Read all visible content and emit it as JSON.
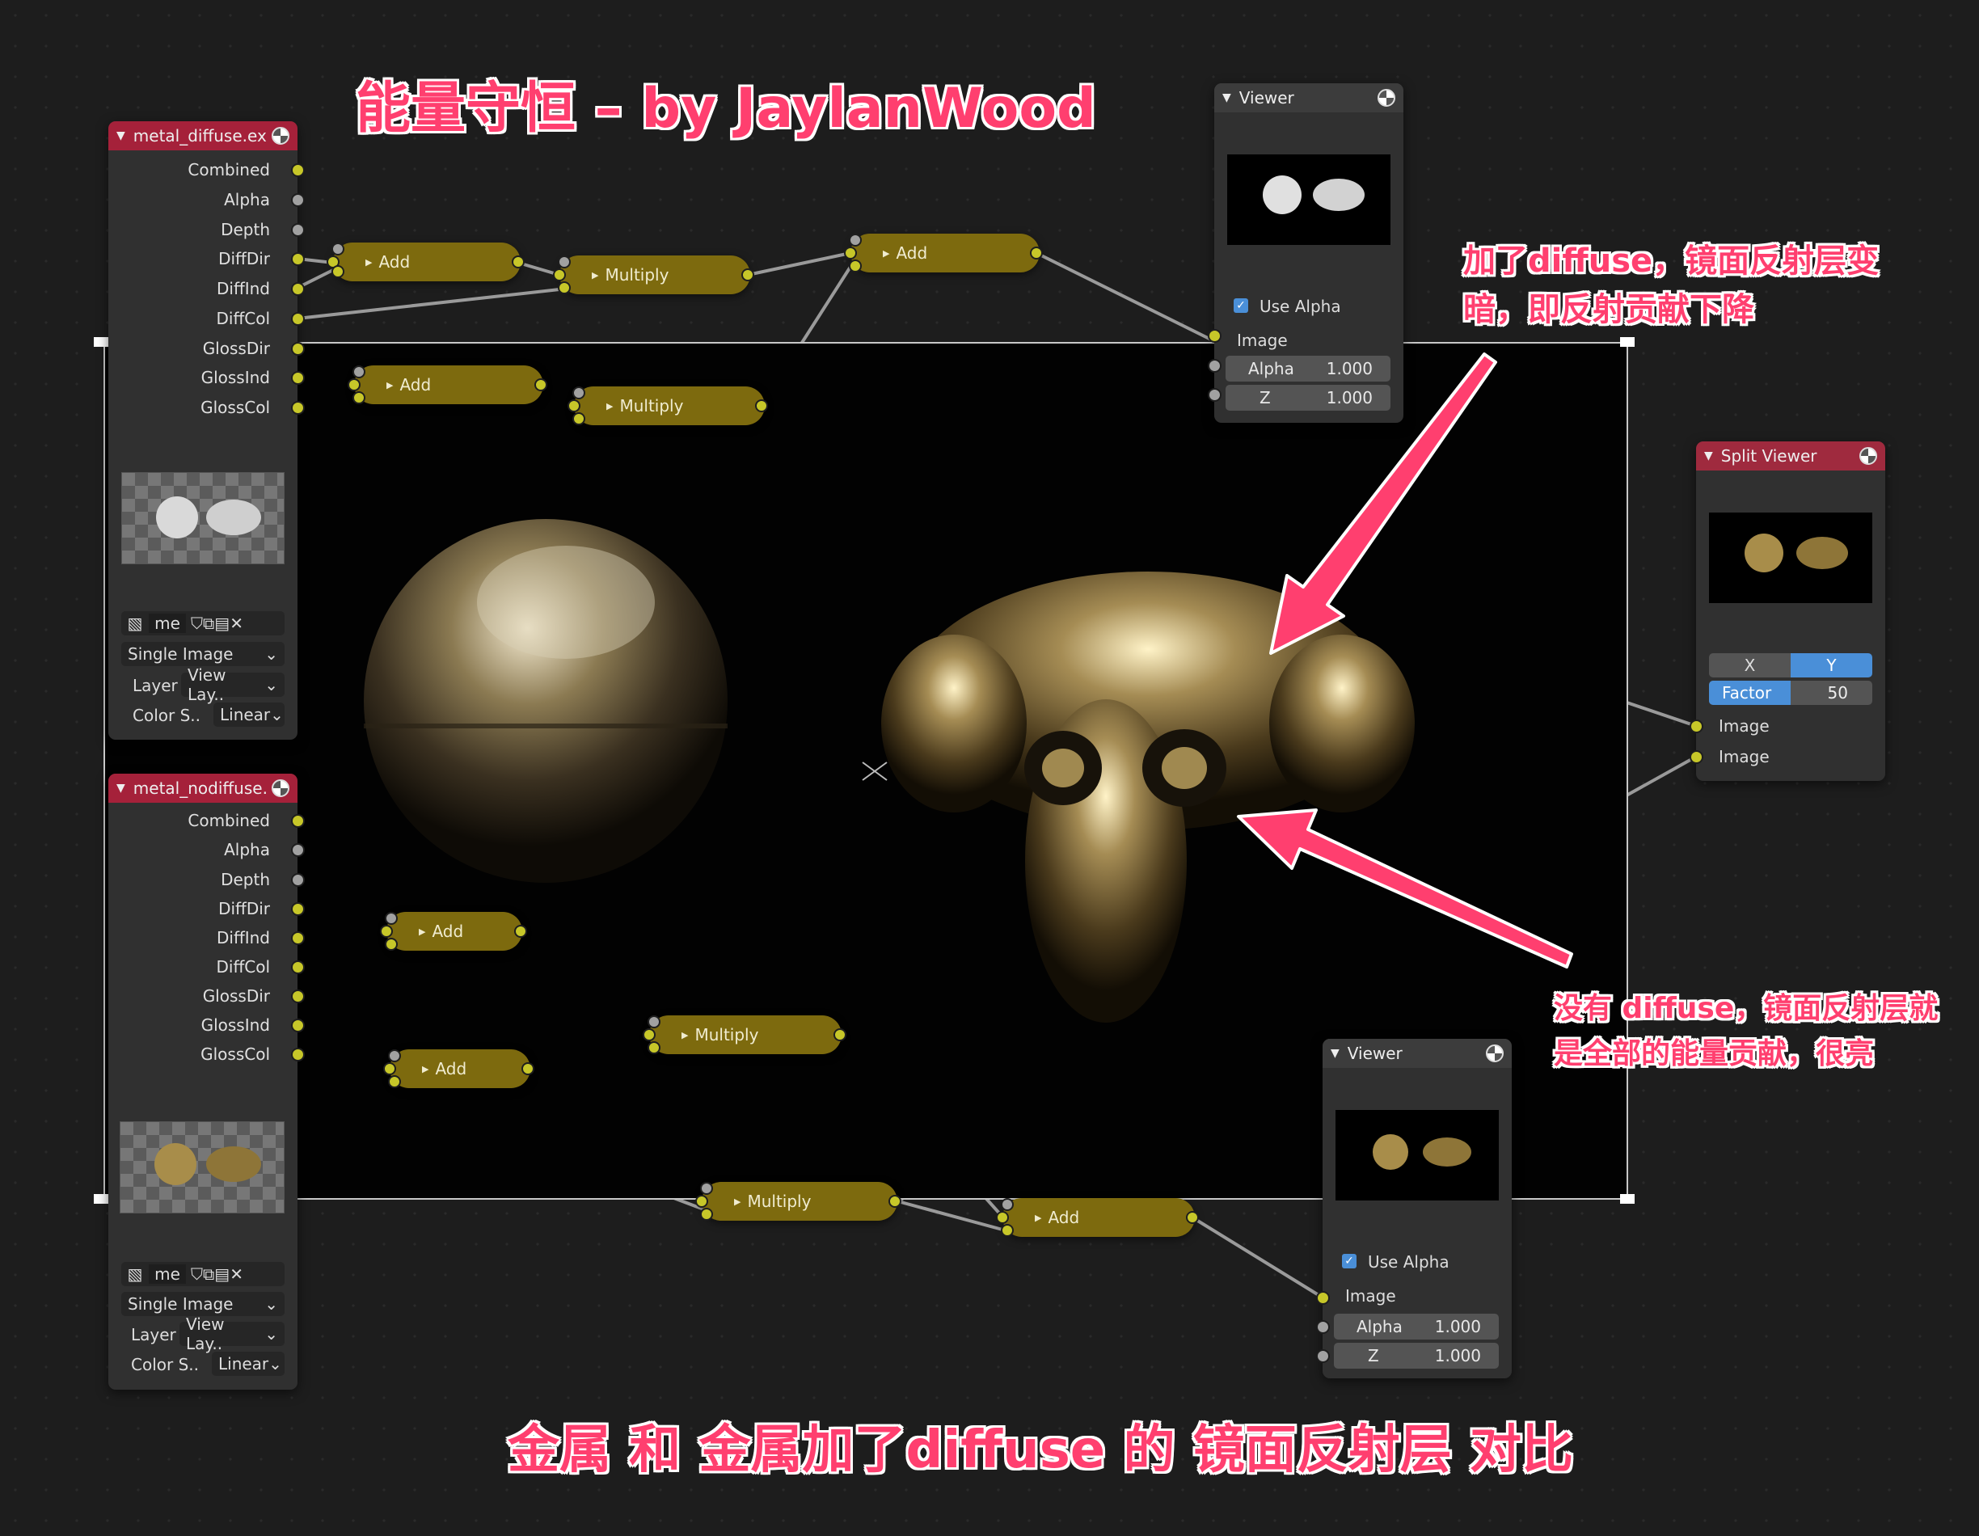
{
  "title_annotation": "能量守恒 – by JaylanWood",
  "bottom_annotation": "金属 和 金属加了diffuse 的 镜面反射层 对比",
  "note_top": [
    "加了diffuse，镜面反射层变",
    "暗，即反射贡献下降"
  ],
  "note_bottom": [
    "没有 diffuse，镜面反射层就",
    "是全部的能量贡献，很亮"
  ],
  "image_node_1": {
    "title": "metal_diffuse.ex",
    "outputs": [
      "Combined",
      "Alpha",
      "Depth",
      "DiffDir",
      "DiffInd",
      "DiffCol",
      "GlossDir",
      "GlossInd",
      "GlossCol"
    ],
    "name_field": "me",
    "source": "Single Image",
    "layer_label": "Layer",
    "layer_value": "View Lay..",
    "color_label": "Color S..",
    "color_value": "Linear"
  },
  "image_node_2": {
    "title": "metal_nodiffuse.",
    "outputs": [
      "Combined",
      "Alpha",
      "Depth",
      "DiffDir",
      "DiffInd",
      "DiffCol",
      "GlossDir",
      "GlossInd",
      "GlossCol"
    ],
    "name_field": "me",
    "source": "Single Image",
    "layer_label": "Layer",
    "layer_value": "View Lay..",
    "color_label": "Color S..",
    "color_value": "Linear"
  },
  "math_nodes": {
    "add": "Add",
    "multiply": "Multiply"
  },
  "viewer_top": {
    "title": "Viewer",
    "use_alpha": "Use Alpha",
    "image": "Image",
    "alpha_label": "Alpha",
    "alpha_value": "1.000",
    "z_label": "Z",
    "z_value": "1.000"
  },
  "viewer_bottom": {
    "title": "Viewer",
    "use_alpha": "Use Alpha",
    "image": "Image",
    "alpha_label": "Alpha",
    "alpha_value": "1.000",
    "z_label": "Z",
    "z_value": "1.000"
  },
  "split_viewer": {
    "title": "Split Viewer",
    "axis_x": "X",
    "axis_y": "Y",
    "factor_label": "Factor",
    "factor_value": "50",
    "input_1": "Image",
    "input_2": "Image"
  },
  "colors": {
    "node_header_red": "#a5213a",
    "math_node": "#7d6a0e",
    "socket_yellow": "#c7c729",
    "annotation_pink": "#ff3f6f",
    "accent_blue": "#4a8fd8"
  }
}
